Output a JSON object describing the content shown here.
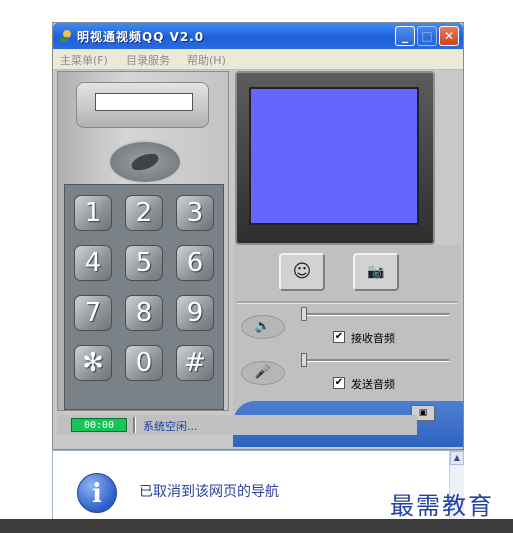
{
  "window": {
    "title": "明视通视频QQ V2.0",
    "minimize_symbol": "_",
    "maximize_symbol": "□",
    "close_symbol": "✕"
  },
  "menu": {
    "items": [
      "主菜单(F)",
      "目录服务",
      "帮助(H)"
    ]
  },
  "keypad": {
    "keys": [
      "1",
      "2",
      "3",
      "4",
      "5",
      "6",
      "7",
      "8",
      "9",
      "✻",
      "0",
      "#"
    ]
  },
  "controls": {
    "smile_symbol": "☺",
    "snapshot_symbol": "📷",
    "speaker_symbol": "🔈",
    "mic_symbol": "🎤",
    "receive_audio_label": "接收音频",
    "receive_audio_checked": true,
    "send_audio_label": "发送音频",
    "send_audio_checked": true,
    "check_symbol": "✔",
    "small_button_symbol": "▣"
  },
  "status": {
    "timer": "00:00",
    "text": "系统空闲..."
  },
  "browser": {
    "info_symbol": "i",
    "message": "已取消到该网页的导航",
    "scroll_up_symbol": "▲"
  },
  "watermark": "最需教育",
  "colors": {
    "titlebar": "#2a6be0",
    "video_screen": "#6666ff",
    "timer_bg": "#18c45a",
    "status_text": "#1a3fa8"
  }
}
